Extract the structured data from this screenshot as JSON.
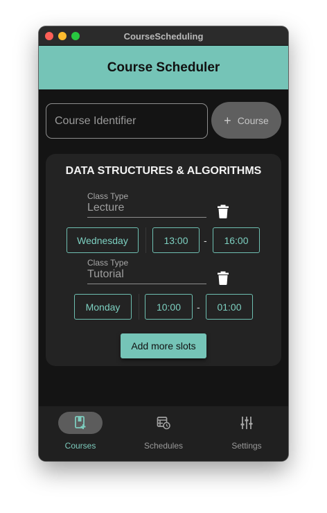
{
  "window": {
    "title": "CourseScheduling"
  },
  "appbar": {
    "title": "Course Scheduler"
  },
  "course_input": {
    "placeholder": "Course Identifier",
    "add_label": "Course"
  },
  "course": {
    "name": "DATA STRUCTURES & ALGORITHMS",
    "slots": [
      {
        "type_label": "Class Type",
        "type": "Lecture",
        "day": "Wednesday",
        "start": "13:00",
        "end": "16:00"
      },
      {
        "type_label": "Class Type",
        "type": "Tutorial",
        "day": "Monday",
        "start": "10:00",
        "end": "01:00"
      }
    ],
    "time_separator": "-",
    "add_slots_label": "Add more slots"
  },
  "nav": {
    "items": [
      {
        "label": "Courses",
        "icon": "courses-icon",
        "active": true
      },
      {
        "label": "Schedules",
        "icon": "schedules-icon",
        "active": false
      },
      {
        "label": "Settings",
        "icon": "settings-icon",
        "active": false
      }
    ]
  },
  "colors": {
    "accent": "#75c4b7",
    "background": "#141414",
    "card": "#232323",
    "chip_border": "#6fc0b2",
    "navbar": "#202020"
  }
}
